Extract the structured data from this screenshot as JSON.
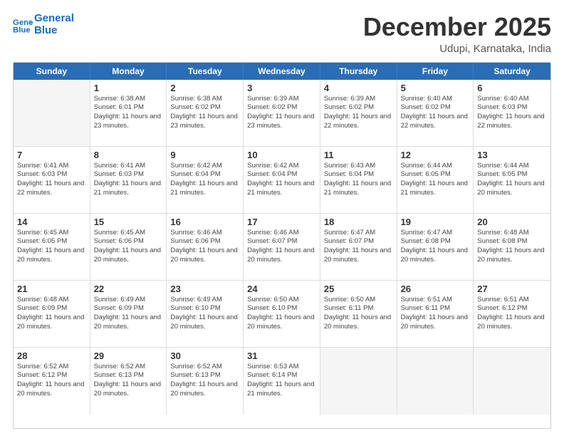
{
  "header": {
    "logo_line1": "General",
    "logo_line2": "Blue",
    "month_title": "December 2025",
    "subtitle": "Udupi, Karnataka, India"
  },
  "weekdays": [
    "Sunday",
    "Monday",
    "Tuesday",
    "Wednesday",
    "Thursday",
    "Friday",
    "Saturday"
  ],
  "rows": [
    [
      {
        "day": "",
        "rise": "",
        "set": "",
        "daylight": "",
        "shaded": true
      },
      {
        "day": "1",
        "rise": "Sunrise: 6:38 AM",
        "set": "Sunset: 6:01 PM",
        "daylight": "Daylight: 11 hours and 23 minutes.",
        "shaded": false
      },
      {
        "day": "2",
        "rise": "Sunrise: 6:38 AM",
        "set": "Sunset: 6:02 PM",
        "daylight": "Daylight: 11 hours and 23 minutes.",
        "shaded": false
      },
      {
        "day": "3",
        "rise": "Sunrise: 6:39 AM",
        "set": "Sunset: 6:02 PM",
        "daylight": "Daylight: 11 hours and 23 minutes.",
        "shaded": false
      },
      {
        "day": "4",
        "rise": "Sunrise: 6:39 AM",
        "set": "Sunset: 6:02 PM",
        "daylight": "Daylight: 11 hours and 22 minutes.",
        "shaded": false
      },
      {
        "day": "5",
        "rise": "Sunrise: 6:40 AM",
        "set": "Sunset: 6:02 PM",
        "daylight": "Daylight: 11 hours and 22 minutes.",
        "shaded": false
      },
      {
        "day": "6",
        "rise": "Sunrise: 6:40 AM",
        "set": "Sunset: 6:03 PM",
        "daylight": "Daylight: 11 hours and 22 minutes.",
        "shaded": false
      }
    ],
    [
      {
        "day": "7",
        "rise": "Sunrise: 6:41 AM",
        "set": "Sunset: 6:03 PM",
        "daylight": "Daylight: 11 hours and 22 minutes.",
        "shaded": false
      },
      {
        "day": "8",
        "rise": "Sunrise: 6:41 AM",
        "set": "Sunset: 6:03 PM",
        "daylight": "Daylight: 11 hours and 21 minutes.",
        "shaded": false
      },
      {
        "day": "9",
        "rise": "Sunrise: 6:42 AM",
        "set": "Sunset: 6:04 PM",
        "daylight": "Daylight: 11 hours and 21 minutes.",
        "shaded": false
      },
      {
        "day": "10",
        "rise": "Sunrise: 6:42 AM",
        "set": "Sunset: 6:04 PM",
        "daylight": "Daylight: 11 hours and 21 minutes.",
        "shaded": false
      },
      {
        "day": "11",
        "rise": "Sunrise: 6:43 AM",
        "set": "Sunset: 6:04 PM",
        "daylight": "Daylight: 11 hours and 21 minutes.",
        "shaded": false
      },
      {
        "day": "12",
        "rise": "Sunrise: 6:44 AM",
        "set": "Sunset: 6:05 PM",
        "daylight": "Daylight: 11 hours and 21 minutes.",
        "shaded": false
      },
      {
        "day": "13",
        "rise": "Sunrise: 6:44 AM",
        "set": "Sunset: 6:05 PM",
        "daylight": "Daylight: 11 hours and 20 minutes.",
        "shaded": false
      }
    ],
    [
      {
        "day": "14",
        "rise": "Sunrise: 6:45 AM",
        "set": "Sunset: 6:05 PM",
        "daylight": "Daylight: 11 hours and 20 minutes.",
        "shaded": false
      },
      {
        "day": "15",
        "rise": "Sunrise: 6:45 AM",
        "set": "Sunset: 6:06 PM",
        "daylight": "Daylight: 11 hours and 20 minutes.",
        "shaded": false
      },
      {
        "day": "16",
        "rise": "Sunrise: 6:46 AM",
        "set": "Sunset: 6:06 PM",
        "daylight": "Daylight: 11 hours and 20 minutes.",
        "shaded": false
      },
      {
        "day": "17",
        "rise": "Sunrise: 6:46 AM",
        "set": "Sunset: 6:07 PM",
        "daylight": "Daylight: 11 hours and 20 minutes.",
        "shaded": false
      },
      {
        "day": "18",
        "rise": "Sunrise: 6:47 AM",
        "set": "Sunset: 6:07 PM",
        "daylight": "Daylight: 11 hours and 20 minutes.",
        "shaded": false
      },
      {
        "day": "19",
        "rise": "Sunrise: 6:47 AM",
        "set": "Sunset: 6:08 PM",
        "daylight": "Daylight: 11 hours and 20 minutes.",
        "shaded": false
      },
      {
        "day": "20",
        "rise": "Sunrise: 6:48 AM",
        "set": "Sunset: 6:08 PM",
        "daylight": "Daylight: 11 hours and 20 minutes.",
        "shaded": false
      }
    ],
    [
      {
        "day": "21",
        "rise": "Sunrise: 6:48 AM",
        "set": "Sunset: 6:09 PM",
        "daylight": "Daylight: 11 hours and 20 minutes.",
        "shaded": false
      },
      {
        "day": "22",
        "rise": "Sunrise: 6:49 AM",
        "set": "Sunset: 6:09 PM",
        "daylight": "Daylight: 11 hours and 20 minutes.",
        "shaded": false
      },
      {
        "day": "23",
        "rise": "Sunrise: 6:49 AM",
        "set": "Sunset: 6:10 PM",
        "daylight": "Daylight: 11 hours and 20 minutes.",
        "shaded": false
      },
      {
        "day": "24",
        "rise": "Sunrise: 6:50 AM",
        "set": "Sunset: 6:10 PM",
        "daylight": "Daylight: 11 hours and 20 minutes.",
        "shaded": false
      },
      {
        "day": "25",
        "rise": "Sunrise: 6:50 AM",
        "set": "Sunset: 6:11 PM",
        "daylight": "Daylight: 11 hours and 20 minutes.",
        "shaded": false
      },
      {
        "day": "26",
        "rise": "Sunrise: 6:51 AM",
        "set": "Sunset: 6:11 PM",
        "daylight": "Daylight: 11 hours and 20 minutes.",
        "shaded": false
      },
      {
        "day": "27",
        "rise": "Sunrise: 6:51 AM",
        "set": "Sunset: 6:12 PM",
        "daylight": "Daylight: 11 hours and 20 minutes.",
        "shaded": false
      }
    ],
    [
      {
        "day": "28",
        "rise": "Sunrise: 6:52 AM",
        "set": "Sunset: 6:12 PM",
        "daylight": "Daylight: 11 hours and 20 minutes.",
        "shaded": false
      },
      {
        "day": "29",
        "rise": "Sunrise: 6:52 AM",
        "set": "Sunset: 6:13 PM",
        "daylight": "Daylight: 11 hours and 20 minutes.",
        "shaded": false
      },
      {
        "day": "30",
        "rise": "Sunrise: 6:52 AM",
        "set": "Sunset: 6:13 PM",
        "daylight": "Daylight: 11 hours and 20 minutes.",
        "shaded": false
      },
      {
        "day": "31",
        "rise": "Sunrise: 6:53 AM",
        "set": "Sunset: 6:14 PM",
        "daylight": "Daylight: 11 hours and 21 minutes.",
        "shaded": false
      },
      {
        "day": "",
        "rise": "",
        "set": "",
        "daylight": "",
        "shaded": true
      },
      {
        "day": "",
        "rise": "",
        "set": "",
        "daylight": "",
        "shaded": true
      },
      {
        "day": "",
        "rise": "",
        "set": "",
        "daylight": "",
        "shaded": true
      }
    ]
  ]
}
